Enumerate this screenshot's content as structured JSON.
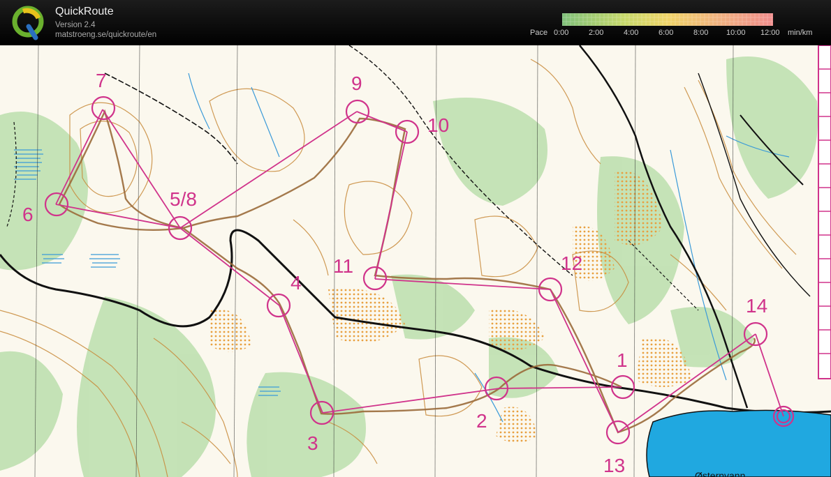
{
  "app": {
    "title": "QuickRoute",
    "version": "Version 2.4",
    "url": "matstroeng.se/quickroute/en",
    "logo_letter": "Q"
  },
  "pace_legend": {
    "label": "Pace",
    "ticks": [
      "0:00",
      "2:00",
      "4:00",
      "6:00",
      "8:00",
      "10:00",
      "12:00"
    ],
    "unit": "min/km",
    "colors": [
      "#7fc07a",
      "#c8d96a",
      "#f0d468",
      "#f0a080",
      "#f08c8c"
    ]
  },
  "map": {
    "lake_name": "Østernvann",
    "course_color": "#d0338b",
    "route_color": "#9a6a3a",
    "controls": [
      {
        "label": "1"
      },
      {
        "label": "2"
      },
      {
        "label": "3"
      },
      {
        "label": "4"
      },
      {
        "label": "5/8"
      },
      {
        "label": "6"
      },
      {
        "label": "7"
      },
      {
        "label": "9"
      },
      {
        "label": "10"
      },
      {
        "label": "11"
      },
      {
        "label": "12"
      },
      {
        "label": "13"
      },
      {
        "label": "14"
      }
    ]
  }
}
